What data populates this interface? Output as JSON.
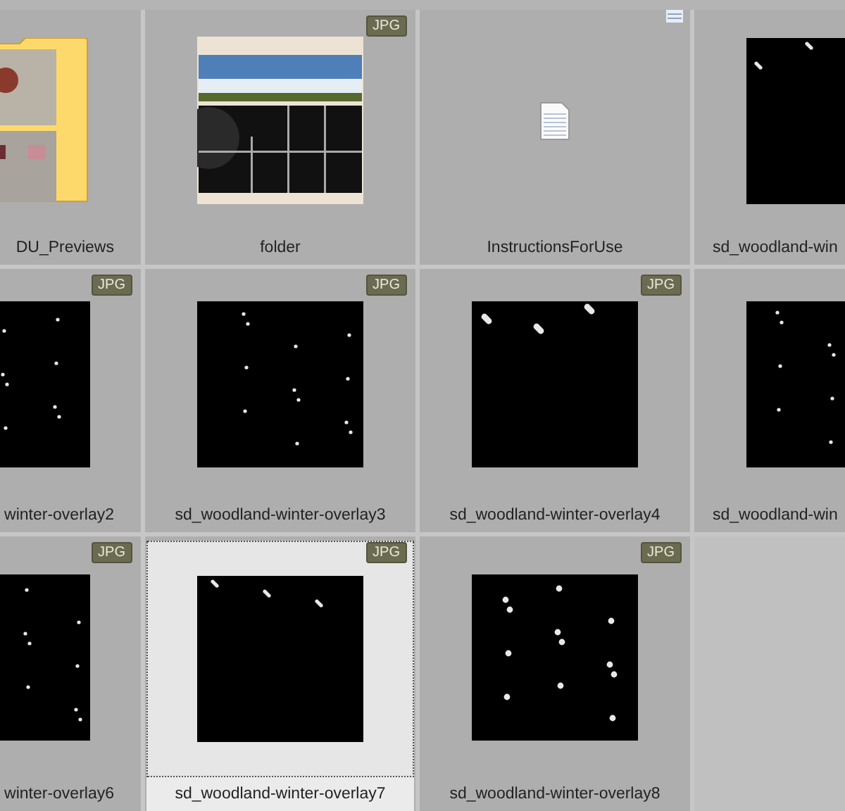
{
  "items": [
    {
      "label": "DU_Previews",
      "kind": "folder",
      "selected": false
    },
    {
      "label": "folder",
      "badge": "JPG",
      "selected": false
    },
    {
      "label": "InstructionsForUse",
      "kind": "document",
      "selected": false
    },
    {
      "label": "sd_woodland-win",
      "selected": false
    },
    {
      "label": "winter-overlay2",
      "badge": "JPG",
      "selected": false
    },
    {
      "label": "sd_woodland-winter-overlay3",
      "badge": "JPG",
      "selected": false
    },
    {
      "label": "sd_woodland-winter-overlay4",
      "badge": "JPG",
      "selected": false
    },
    {
      "label": "sd_woodland-win",
      "selected": false
    },
    {
      "label": "winter-overlay6",
      "badge": "JPG",
      "selected": false
    },
    {
      "label": "sd_woodland-winter-overlay7",
      "badge": "JPG",
      "selected": true
    },
    {
      "label": "sd_woodland-winter-overlay8",
      "badge": "JPG",
      "selected": false
    }
  ]
}
